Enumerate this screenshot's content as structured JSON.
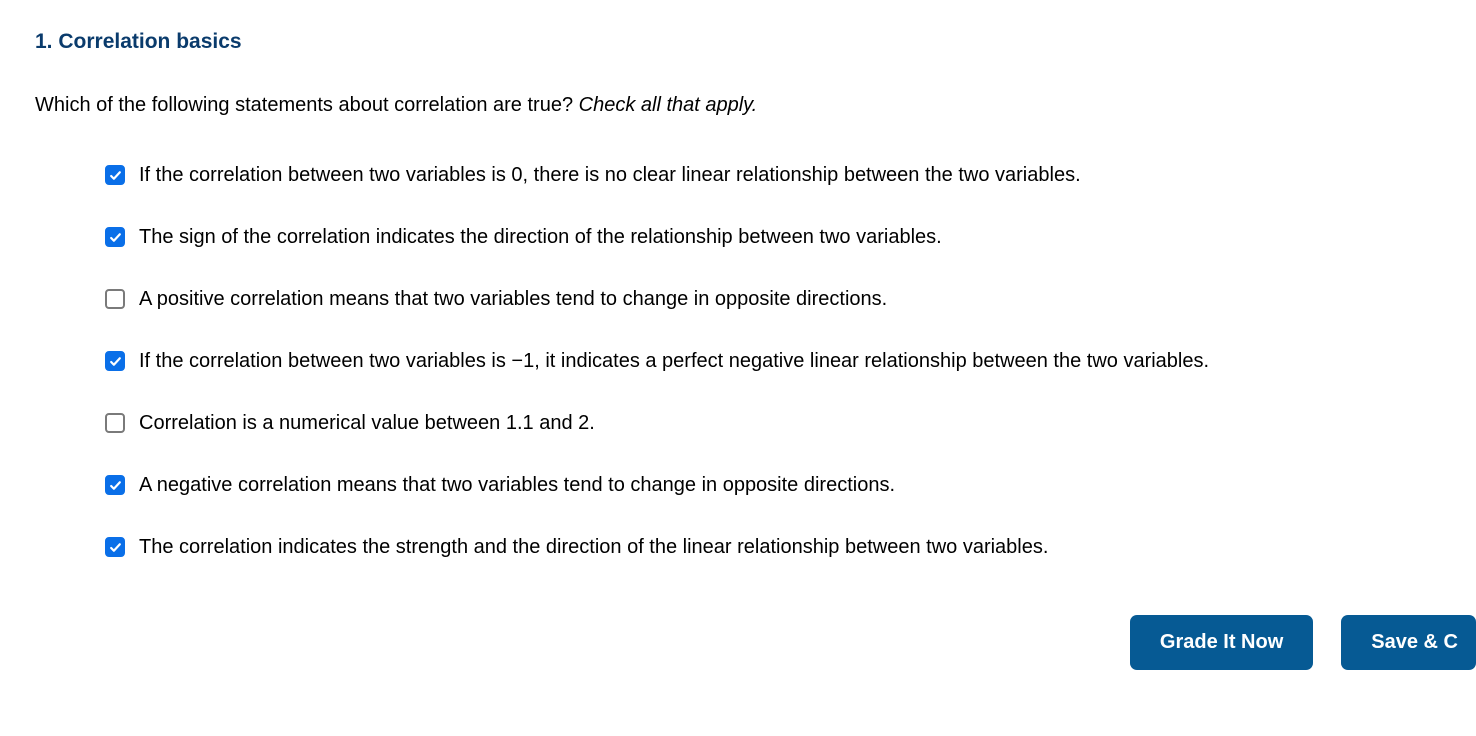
{
  "question": {
    "number": "1.",
    "title": "Correlation basics",
    "prompt_main": "Which of the following statements about correlation are true? ",
    "prompt_hint": "Check all that apply."
  },
  "options": [
    {
      "checked": true,
      "label": "If the correlation between two variables is 0, there is no clear linear relationship between the two variables."
    },
    {
      "checked": true,
      "label": "The sign of the correlation indicates the direction of the relationship between two variables."
    },
    {
      "checked": false,
      "label": "A positive correlation means that two variables tend to change in opposite directions."
    },
    {
      "checked": true,
      "label": "If the correlation between two variables is −1, it indicates a perfect negative linear relationship between the two variables."
    },
    {
      "checked": false,
      "label": "Correlation is a numerical value between 1.1 and 2."
    },
    {
      "checked": true,
      "label": "A negative correlation means that two variables tend to change in opposite directions."
    },
    {
      "checked": true,
      "label": "The correlation indicates the strength and the direction of the linear relationship between two variables."
    }
  ],
  "buttons": {
    "grade": "Grade It Now",
    "save": "Save & C"
  }
}
